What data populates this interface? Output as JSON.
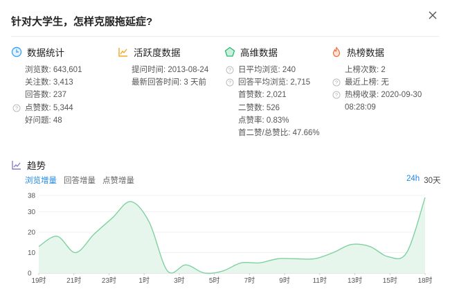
{
  "title": "针对大学生，怎样克服拖延症?",
  "columns": [
    {
      "heading": "数据统计",
      "icon": "clock-icon",
      "rows": [
        {
          "label": "浏览数",
          "value": "643,601",
          "help": false
        },
        {
          "label": "关注数",
          "value": "3,413",
          "help": false
        },
        {
          "label": "回答数",
          "value": "237",
          "help": false
        },
        {
          "label": "点赞数",
          "value": "5,344",
          "help": true
        },
        {
          "label": "好问题",
          "value": "48",
          "help": false
        }
      ]
    },
    {
      "heading": "活跃度数据",
      "icon": "activity-chart-icon",
      "rows": [
        {
          "label": "提问时间",
          "value": "2013-08-24",
          "help": false
        },
        {
          "label": "最新回答时间",
          "value": "3 天前",
          "help": false
        }
      ]
    },
    {
      "heading": "高维数据",
      "icon": "pentagon-icon",
      "rows": [
        {
          "label": "日平均浏览",
          "value": "240",
          "help": true
        },
        {
          "label": "回答平均浏览",
          "value": "2,715",
          "help": true
        },
        {
          "label": "首赞数",
          "value": "2,021",
          "help": false
        },
        {
          "label": "二赞数",
          "value": "526",
          "help": false
        },
        {
          "label": "点赞率",
          "value": "0.83%",
          "help": false
        },
        {
          "label": "首二赞/总赞比",
          "value": "47.66%",
          "help": false
        }
      ]
    },
    {
      "heading": "热榜数据",
      "icon": "flame-icon",
      "rows": [
        {
          "label": "上榜次数",
          "value": "2",
          "help": false
        },
        {
          "label": "最近上榜",
          "value": "无",
          "help": true
        },
        {
          "label": "热榜收录",
          "value": "2020-09-30 08:28:09",
          "help": true
        }
      ]
    }
  ],
  "trend": {
    "heading": "趋势",
    "tabs": [
      "浏览增量",
      "回答增量",
      "点赞增量"
    ],
    "active_tab": 0,
    "ranges": [
      "24h",
      "30天"
    ],
    "active_range": 0
  },
  "colors": {
    "accent": "#1e88e5",
    "line": "#7fd1a0",
    "fill": "#e6f6ec"
  },
  "chart_data": {
    "type": "area",
    "x": [
      "19时",
      "20时",
      "21时",
      "22时",
      "23时",
      "0时",
      "1时",
      "2时",
      "3时",
      "4时",
      "5时",
      "6时",
      "7时",
      "8时",
      "9时",
      "10时",
      "11时",
      "12时",
      "13时",
      "14时",
      "15时",
      "16时",
      "17时",
      "18时"
    ],
    "xticks": [
      "19时",
      "21时",
      "23时",
      "1时",
      "3时",
      "5时",
      "7时",
      "9时",
      "11时",
      "13时",
      "15时",
      "18时"
    ],
    "series": [
      {
        "values": [
          13,
          18,
          10,
          19,
          27,
          35,
          25,
          1,
          4,
          0,
          1,
          5,
          5,
          7,
          7,
          7,
          10,
          14,
          13,
          8,
          10,
          37
        ]
      }
    ],
    "yticks": [
      0,
      10,
      20,
      30,
      38
    ],
    "ylim": [
      0,
      38
    ]
  }
}
